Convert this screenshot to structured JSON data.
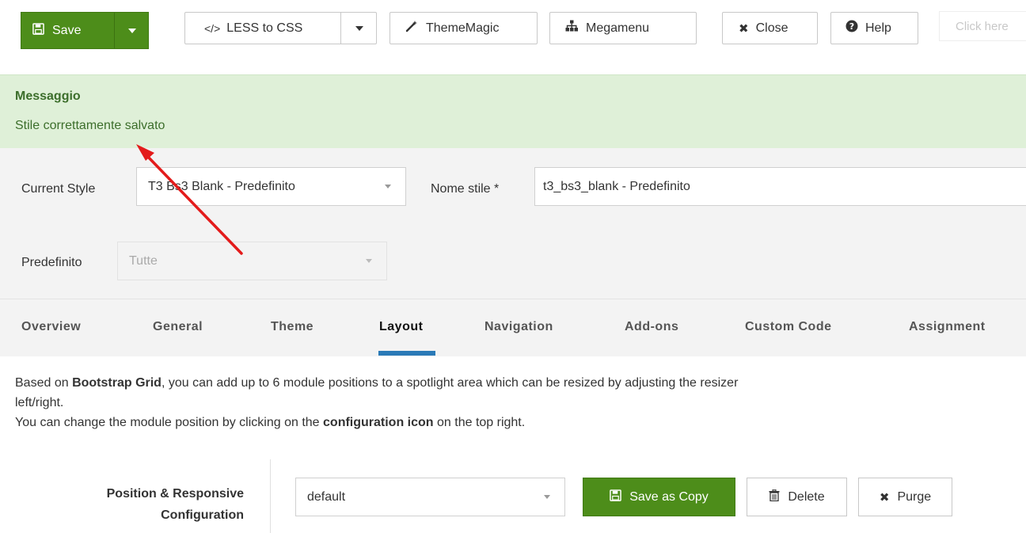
{
  "toolbar": {
    "save_label": "Save",
    "less_label": "LESS to CSS",
    "thememagic_label": "ThemeMagic",
    "megamenu_label": "Megamenu",
    "close_label": "Close",
    "help_label": "Help",
    "hint_text": "Click here"
  },
  "message": {
    "title": "Messaggio",
    "text": "Stile correttamente salvato"
  },
  "style_form": {
    "current_style_label": "Current Style",
    "current_style_value": "T3 Bs3 Blank - Predefinito",
    "style_name_label": "Nome stile *",
    "style_name_value": "t3_bs3_blank - Predefinito",
    "default_label": "Predefinito",
    "default_value": "Tutte"
  },
  "tabs": [
    {
      "label": "Overview"
    },
    {
      "label": "General"
    },
    {
      "label": "Theme"
    },
    {
      "label": "Layout"
    },
    {
      "label": "Navigation"
    },
    {
      "label": "Add-ons"
    },
    {
      "label": "Custom Code"
    },
    {
      "label": "Assignment"
    }
  ],
  "active_tab": "Layout",
  "description": {
    "line1_pre": "Based on ",
    "line1_bold": "Bootstrap Grid",
    "line1_post": ", you can add up to 6 module positions to a spotlight area which can be resized by adjusting the resizer",
    "line2": "left/right.",
    "line3_pre": "You can change the module position by clicking on the ",
    "line3_bold": "configuration icon",
    "line3_post": " on the top right."
  },
  "layout_config": {
    "label_line1": "Position & Responsive",
    "label_line2": "Configuration",
    "layout_value": "default",
    "save_copy_label": "Save as Copy",
    "delete_label": "Delete",
    "purge_label": "Purge"
  },
  "colors": {
    "primary_green": "#4d8d1a",
    "message_bg": "#dff0d8",
    "message_text": "#3c6e2b",
    "tab_active_underline": "#2a7ab7",
    "annotation_arrow": "#e31b1b"
  }
}
